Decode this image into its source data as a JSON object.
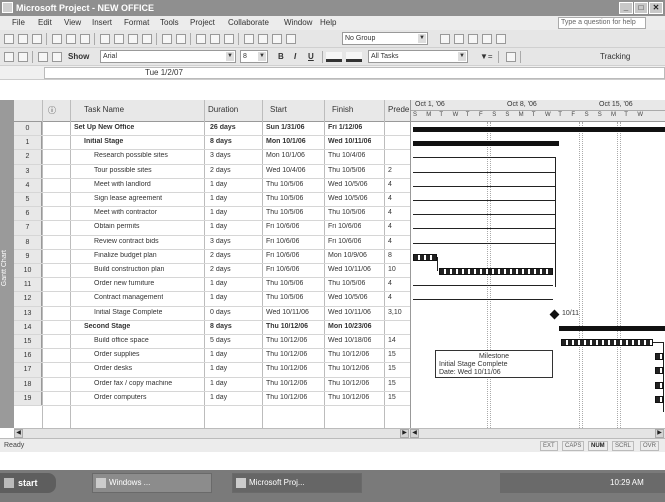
{
  "window": {
    "title": "Microsoft Project - NEW OFFICE",
    "min_glyph": "_",
    "max_glyph": "□",
    "close_glyph": "✕"
  },
  "menu": {
    "items": [
      "File",
      "Edit",
      "View",
      "Insert",
      "Format",
      "Tools",
      "Project",
      "Collaborate",
      "Window",
      "Help"
    ],
    "help_placeholder": "Type a question for help"
  },
  "toolbar": {
    "group_combo": "No Group",
    "font_combo": "Arial",
    "size_combo": "8",
    "bold": "B",
    "italic": "I",
    "underline": "U",
    "filter_combo": "All Tasks",
    "show_label": "Show",
    "tracking_label": "Tracking"
  },
  "entry_bar": {
    "value": "Tue 1/2/07"
  },
  "view_bar": {
    "label": "Gantt Chart"
  },
  "table": {
    "columns": [
      "",
      "Task Name",
      "Duration",
      "Start",
      "Finish",
      "Prede"
    ],
    "rows": [
      {
        "id": "0",
        "name": "Set Up New Office",
        "duration": "26 days",
        "start": "Sun 1/31/06",
        "finish": "Fri 1/12/06",
        "pred": "",
        "summary": true,
        "indent": 0
      },
      {
        "id": "1",
        "name": "Initial Stage",
        "duration": "8 days",
        "start": "Mon 10/1/06",
        "finish": "Wed 10/11/06",
        "pred": "",
        "summary": true,
        "indent": 1
      },
      {
        "id": "2",
        "name": "Research possible sites",
        "duration": "3 days",
        "start": "Mon 10/1/06",
        "finish": "Thu 10/4/06",
        "pred": "",
        "summary": false,
        "indent": 2
      },
      {
        "id": "3",
        "name": "Tour possible sites",
        "duration": "2 days",
        "start": "Wed 10/4/06",
        "finish": "Thu 10/5/06",
        "pred": "2",
        "summary": false,
        "indent": 2
      },
      {
        "id": "4",
        "name": "Meet with landlord",
        "duration": "1 day",
        "start": "Thu 10/5/06",
        "finish": "Wed 10/5/06",
        "pred": "4",
        "summary": false,
        "indent": 2
      },
      {
        "id": "5",
        "name": "Sign lease agreement",
        "duration": "1 day",
        "start": "Thu 10/5/06",
        "finish": "Wed 10/5/06",
        "pred": "4",
        "summary": false,
        "indent": 2
      },
      {
        "id": "6",
        "name": "Meet with contractor",
        "duration": "1 day",
        "start": "Thu 10/5/06",
        "finish": "Thu 10/5/06",
        "pred": "4",
        "summary": false,
        "indent": 2
      },
      {
        "id": "7",
        "name": "Obtain permits",
        "duration": "1 day",
        "start": "Fri 10/6/06",
        "finish": "Fri 10/6/06",
        "pred": "4",
        "summary": false,
        "indent": 2
      },
      {
        "id": "8",
        "name": "Review contract bids",
        "duration": "3 days",
        "start": "Fri 10/6/06",
        "finish": "Fri 10/6/06",
        "pred": "4",
        "summary": false,
        "indent": 2
      },
      {
        "id": "9",
        "name": "Finalize budget plan",
        "duration": "2 days",
        "start": "Fri 10/6/06",
        "finish": "Mon 10/9/06",
        "pred": "8",
        "summary": false,
        "indent": 2
      },
      {
        "id": "10",
        "name": "Build construction plan",
        "duration": "2 days",
        "start": "Fri 10/6/06",
        "finish": "Wed 10/11/06",
        "pred": "10",
        "summary": false,
        "indent": 2
      },
      {
        "id": "11",
        "name": "Order new furniture",
        "duration": "1 day",
        "start": "Thu 10/5/06",
        "finish": "Thu 10/5/06",
        "pred": "4",
        "summary": false,
        "indent": 2
      },
      {
        "id": "12",
        "name": "Contract management",
        "duration": "1 day",
        "start": "Thu 10/5/06",
        "finish": "Wed 10/5/06",
        "pred": "4",
        "summary": false,
        "indent": 2
      },
      {
        "id": "13",
        "name": "Initial Stage Complete",
        "duration": "0 days",
        "start": "Wed 10/11/06",
        "finish": "Wed 10/11/06",
        "pred": "3,10",
        "summary": false,
        "indent": 2
      },
      {
        "id": "14",
        "name": "Second Stage",
        "duration": "8 days",
        "start": "Thu 10/12/06",
        "finish": "Mon 10/23/06",
        "pred": "",
        "summary": true,
        "indent": 1
      },
      {
        "id": "15",
        "name": "Build office space",
        "duration": "5 days",
        "start": "Thu 10/12/06",
        "finish": "Wed 10/18/06",
        "pred": "14",
        "summary": false,
        "indent": 2
      },
      {
        "id": "16",
        "name": "Order supplies",
        "duration": "1 day",
        "start": "Thu 10/12/06",
        "finish": "Thu 10/12/06",
        "pred": "15",
        "summary": false,
        "indent": 2
      },
      {
        "id": "17",
        "name": "Order desks",
        "duration": "1 day",
        "start": "Thu 10/12/06",
        "finish": "Thu 10/12/06",
        "pred": "15",
        "summary": false,
        "indent": 2
      },
      {
        "id": "18",
        "name": "Order fax / copy machine",
        "duration": "1 day",
        "start": "Thu 10/12/06",
        "finish": "Thu 10/12/06",
        "pred": "15",
        "summary": false,
        "indent": 2
      },
      {
        "id": "19",
        "name": "Order computers",
        "duration": "1 day",
        "start": "Thu 10/12/06",
        "finish": "Thu 10/12/06",
        "pred": "15",
        "summary": false,
        "indent": 2
      }
    ]
  },
  "gantt": {
    "weeks": [
      "Oct 1, '06",
      "Oct 8, '06",
      "Oct 15, '06"
    ],
    "days": [
      "S",
      "M",
      "T",
      "W",
      "T",
      "F",
      "S",
      "S",
      "M",
      "T",
      "W",
      "T",
      "F",
      "S",
      "S",
      "M",
      "T",
      "W"
    ],
    "milestone_label": "10/11",
    "callout": {
      "title": "Milestone",
      "line1": "Initial Stage Complete",
      "line2": "Date: Wed 10/11/06"
    }
  },
  "status": {
    "ready": "Ready",
    "indicators": [
      "EXT",
      "CAPS",
      "NUM",
      "SCRL",
      "OVR"
    ]
  },
  "taskbar": {
    "start": "start",
    "buttons": [
      "Windows ...",
      "Microsoft Proj..."
    ],
    "clock": "10:29 AM"
  }
}
